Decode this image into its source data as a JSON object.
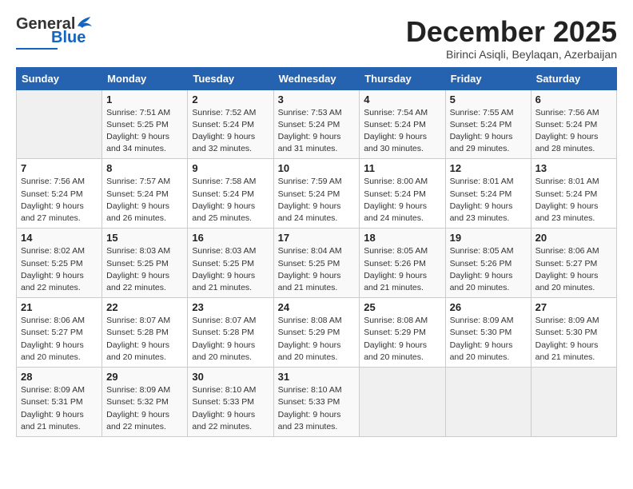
{
  "logo": {
    "general": "General",
    "blue": "Blue"
  },
  "title": "December 2025",
  "subtitle": "Birinci Asiqli, Beylaqan, Azerbaijan",
  "days_of_week": [
    "Sunday",
    "Monday",
    "Tuesday",
    "Wednesday",
    "Thursday",
    "Friday",
    "Saturday"
  ],
  "weeks": [
    [
      {
        "day": "",
        "info": ""
      },
      {
        "day": "1",
        "info": "Sunrise: 7:51 AM\nSunset: 5:25 PM\nDaylight: 9 hours\nand 34 minutes."
      },
      {
        "day": "2",
        "info": "Sunrise: 7:52 AM\nSunset: 5:24 PM\nDaylight: 9 hours\nand 32 minutes."
      },
      {
        "day": "3",
        "info": "Sunrise: 7:53 AM\nSunset: 5:24 PM\nDaylight: 9 hours\nand 31 minutes."
      },
      {
        "day": "4",
        "info": "Sunrise: 7:54 AM\nSunset: 5:24 PM\nDaylight: 9 hours\nand 30 minutes."
      },
      {
        "day": "5",
        "info": "Sunrise: 7:55 AM\nSunset: 5:24 PM\nDaylight: 9 hours\nand 29 minutes."
      },
      {
        "day": "6",
        "info": "Sunrise: 7:56 AM\nSunset: 5:24 PM\nDaylight: 9 hours\nand 28 minutes."
      }
    ],
    [
      {
        "day": "7",
        "info": "Sunrise: 7:56 AM\nSunset: 5:24 PM\nDaylight: 9 hours\nand 27 minutes."
      },
      {
        "day": "8",
        "info": "Sunrise: 7:57 AM\nSunset: 5:24 PM\nDaylight: 9 hours\nand 26 minutes."
      },
      {
        "day": "9",
        "info": "Sunrise: 7:58 AM\nSunset: 5:24 PM\nDaylight: 9 hours\nand 25 minutes."
      },
      {
        "day": "10",
        "info": "Sunrise: 7:59 AM\nSunset: 5:24 PM\nDaylight: 9 hours\nand 24 minutes."
      },
      {
        "day": "11",
        "info": "Sunrise: 8:00 AM\nSunset: 5:24 PM\nDaylight: 9 hours\nand 24 minutes."
      },
      {
        "day": "12",
        "info": "Sunrise: 8:01 AM\nSunset: 5:24 PM\nDaylight: 9 hours\nand 23 minutes."
      },
      {
        "day": "13",
        "info": "Sunrise: 8:01 AM\nSunset: 5:24 PM\nDaylight: 9 hours\nand 23 minutes."
      }
    ],
    [
      {
        "day": "14",
        "info": "Sunrise: 8:02 AM\nSunset: 5:25 PM\nDaylight: 9 hours\nand 22 minutes."
      },
      {
        "day": "15",
        "info": "Sunrise: 8:03 AM\nSunset: 5:25 PM\nDaylight: 9 hours\nand 22 minutes."
      },
      {
        "day": "16",
        "info": "Sunrise: 8:03 AM\nSunset: 5:25 PM\nDaylight: 9 hours\nand 21 minutes."
      },
      {
        "day": "17",
        "info": "Sunrise: 8:04 AM\nSunset: 5:25 PM\nDaylight: 9 hours\nand 21 minutes."
      },
      {
        "day": "18",
        "info": "Sunrise: 8:05 AM\nSunset: 5:26 PM\nDaylight: 9 hours\nand 21 minutes."
      },
      {
        "day": "19",
        "info": "Sunrise: 8:05 AM\nSunset: 5:26 PM\nDaylight: 9 hours\nand 20 minutes."
      },
      {
        "day": "20",
        "info": "Sunrise: 8:06 AM\nSunset: 5:27 PM\nDaylight: 9 hours\nand 20 minutes."
      }
    ],
    [
      {
        "day": "21",
        "info": "Sunrise: 8:06 AM\nSunset: 5:27 PM\nDaylight: 9 hours\nand 20 minutes."
      },
      {
        "day": "22",
        "info": "Sunrise: 8:07 AM\nSunset: 5:28 PM\nDaylight: 9 hours\nand 20 minutes."
      },
      {
        "day": "23",
        "info": "Sunrise: 8:07 AM\nSunset: 5:28 PM\nDaylight: 9 hours\nand 20 minutes."
      },
      {
        "day": "24",
        "info": "Sunrise: 8:08 AM\nSunset: 5:29 PM\nDaylight: 9 hours\nand 20 minutes."
      },
      {
        "day": "25",
        "info": "Sunrise: 8:08 AM\nSunset: 5:29 PM\nDaylight: 9 hours\nand 20 minutes."
      },
      {
        "day": "26",
        "info": "Sunrise: 8:09 AM\nSunset: 5:30 PM\nDaylight: 9 hours\nand 20 minutes."
      },
      {
        "day": "27",
        "info": "Sunrise: 8:09 AM\nSunset: 5:30 PM\nDaylight: 9 hours\nand 21 minutes."
      }
    ],
    [
      {
        "day": "28",
        "info": "Sunrise: 8:09 AM\nSunset: 5:31 PM\nDaylight: 9 hours\nand 21 minutes."
      },
      {
        "day": "29",
        "info": "Sunrise: 8:09 AM\nSunset: 5:32 PM\nDaylight: 9 hours\nand 22 minutes."
      },
      {
        "day": "30",
        "info": "Sunrise: 8:10 AM\nSunset: 5:33 PM\nDaylight: 9 hours\nand 22 minutes."
      },
      {
        "day": "31",
        "info": "Sunrise: 8:10 AM\nSunset: 5:33 PM\nDaylight: 9 hours\nand 23 minutes."
      },
      {
        "day": "",
        "info": ""
      },
      {
        "day": "",
        "info": ""
      },
      {
        "day": "",
        "info": ""
      }
    ]
  ]
}
